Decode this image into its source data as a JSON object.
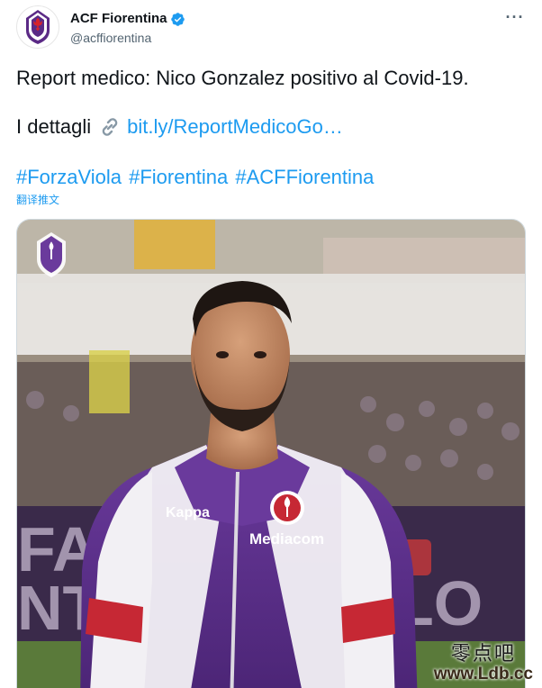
{
  "tweet": {
    "author": {
      "display_name": "ACF Fiorentina",
      "handle": "@acffiorentina",
      "verified": true,
      "avatar_icon": "fiorentina-crest-icon"
    },
    "more_icon": "more-options-icon",
    "text_line1": "Report medico: Nico Gonzalez positivo al Covid-19.",
    "text_line2_prefix": "I dettagli",
    "link_icon": "link-icon",
    "link_text": "bit.ly/ReportMedicoGo…",
    "hashtags": [
      "#ForzaViola",
      "#Fiorentina",
      "#ACFFiorentina"
    ],
    "translate_label": "翻译推文"
  },
  "media": {
    "description_icon": "player-photo",
    "shirt_sponsor": "Mediacom",
    "kit_brand": "Kappa",
    "crest_icon": "fiorentina-crest-icon",
    "background_letters_left": "FA\nNT",
    "background_letters_right": "LO"
  },
  "watermark": {
    "chars": "零点吧",
    "url": "www.Ldb.cc"
  },
  "colors": {
    "accent": "#1d9bf0",
    "viola": "#5b2a86",
    "text": "#0f1419",
    "muted": "#536471"
  }
}
